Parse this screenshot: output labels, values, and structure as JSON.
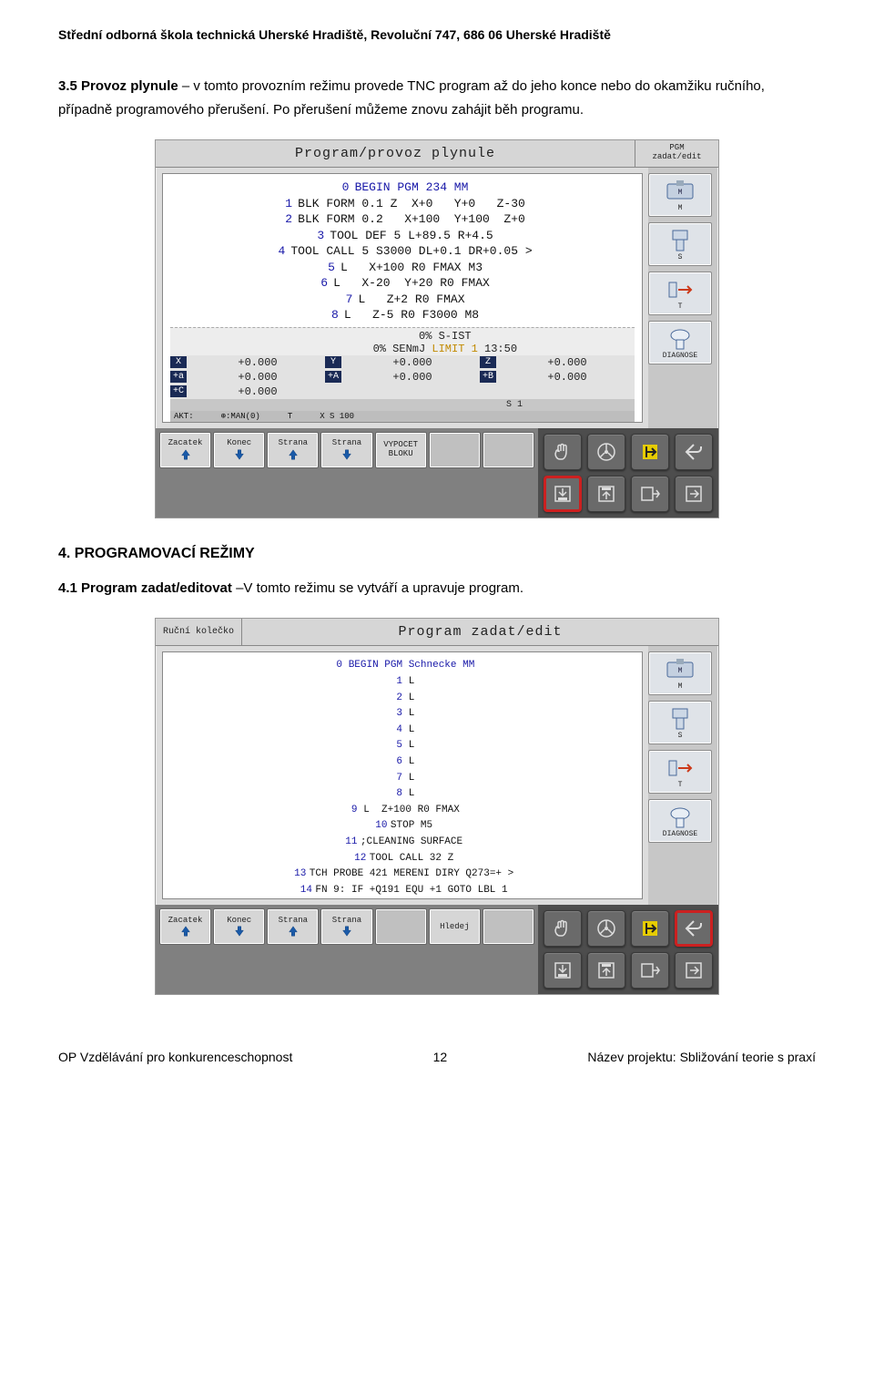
{
  "header": "Střední odborná škola technická Uherské Hradiště, Revoluční 747, 686 06 Uherské Hradiště",
  "para1_bold": "3.5 Provoz plynule",
  "para1_rest": " – v tomto provozním režimu provede TNC program až do jeho konce nebo do okamžiku ručního, případně programového přerušení. Po přerušení můžeme znovu zahájit běh programu.",
  "section4_heading": "4. PROGRAMOVACÍ REŽIMY",
  "para2_bold": "4.1 Program zadat/editovat",
  "para2_rest": " –V tomto režimu se vytváří a upravuje program.",
  "fig1": {
    "title": "Program/provoz plynule",
    "title_right": "PGM\nzadat/edit",
    "program_lines": [
      {
        "n": "0",
        "txt": "BEGIN PGM 234 MM",
        "begin": true
      },
      {
        "n": "1",
        "txt": "BLK FORM 0.1 Z  X+0   Y+0   Z-30"
      },
      {
        "n": "2",
        "txt": "BLK FORM 0.2   X+100  Y+100  Z+0"
      },
      {
        "n": "3",
        "txt": "TOOL DEF 5 L+89.5 R+4.5"
      },
      {
        "n": "4",
        "txt": "TOOL CALL 5 S3000 DL+0.1 DR+0.05 >"
      },
      {
        "n": "5",
        "txt": "L   X+100 R0 FMAX M3"
      },
      {
        "n": "6",
        "txt": "L   X-20  Y+20 R0 FMAX"
      },
      {
        "n": "7",
        "txt": "L   Z+2 R0 FMAX"
      },
      {
        "n": "8",
        "txt": "L   Z-5 R0 F3000 M8"
      }
    ],
    "status": {
      "line1": "             0% S-IST",
      "line2": "             0% SENmJ ",
      "limit": "LIMIT 1",
      "time": " 13:50"
    },
    "coords": [
      [
        {
          "l": "X",
          "v": "+0.000"
        },
        {
          "l": "Y",
          "v": "+0.000"
        },
        {
          "l": "Z",
          "v": "+0.000"
        }
      ],
      [
        {
          "l": "+a",
          "v": "+0.000"
        },
        {
          "l": "+A",
          "v": "+0.000"
        },
        {
          "l": "+B",
          "v": "+0.000"
        }
      ],
      [
        {
          "l": "+C",
          "v": "+0.000"
        },
        {
          "l": "",
          "v": ""
        },
        {
          "l": "",
          "v": ""
        }
      ]
    ],
    "s_strip": "                                         S 1",
    "akt_row": [
      "AKT:",
      "⊕:MAN(0)",
      "T",
      "X S 100",
      ""
    ],
    "side_labels": [
      "M",
      "S",
      "T",
      "DIAGNOSE"
    ],
    "soft_keys": [
      "Zacatek",
      "Konec",
      "Strana",
      "Strana",
      "VYPOCET\nBLOKU",
      "",
      ""
    ],
    "icon_grid_red_index": 4
  },
  "fig2": {
    "mode_tab": "Ruční kolečko",
    "title": "Program zadat/edit",
    "title_right": "",
    "program_lines": [
      {
        "n": "0",
        "txt": "BEGIN PGM Schnecke MM",
        "begin": true
      },
      {
        "n": "1",
        "txt": "L"
      },
      {
        "n": "2",
        "txt": "L"
      },
      {
        "n": "3",
        "txt": "L"
      },
      {
        "n": "4",
        "txt": "L"
      },
      {
        "n": "5",
        "txt": "L"
      },
      {
        "n": "6",
        "txt": "L"
      },
      {
        "n": "7",
        "txt": "L"
      },
      {
        "n": "8",
        "txt": "L"
      },
      {
        "n": "9",
        "txt": "L  Z+100 R0 FMAX"
      },
      {
        "n": "10",
        "txt": "STOP M5"
      },
      {
        "n": "11",
        "txt": ";CLEANING SURFACE"
      },
      {
        "n": "12",
        "txt": "TOOL CALL 32 Z"
      },
      {
        "n": "13",
        "txt": "TCH PROBE 421 MERENI DIRY Q273=+ >"
      },
      {
        "n": "14",
        "txt": "FN 9: IF +Q191 EQU +1 GOTO LBL 1"
      }
    ],
    "side_labels": [
      "M",
      "S",
      "T",
      "DIAGNOSE"
    ],
    "soft_keys": [
      "Zacatek",
      "Konec",
      "Strana",
      "Strana",
      "",
      "Hledej",
      ""
    ],
    "icon_grid_red_index": 3
  },
  "footer": {
    "left": "OP Vzdělávání pro konkurenceschopnost",
    "page": "12",
    "right": "Název projektu: Sbližování teorie s praxí"
  }
}
